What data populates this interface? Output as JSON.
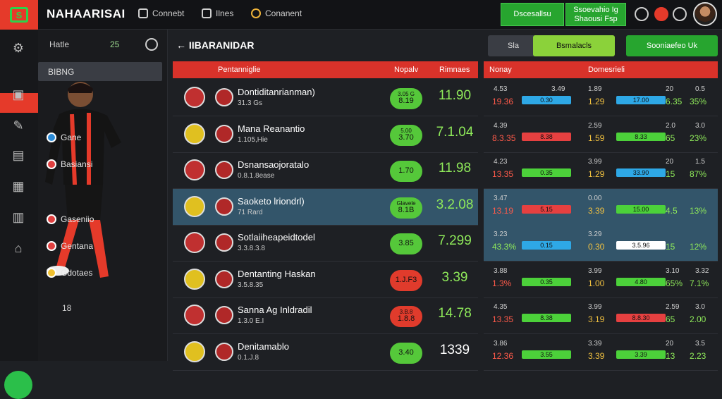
{
  "brand": {
    "logo": "S",
    "name": "NAHAARISAI"
  },
  "nav": [
    {
      "label": "Connebt",
      "icon": "link-icon"
    },
    {
      "label": "Ilnes",
      "icon": "list-icon"
    },
    {
      "label": "Conanent",
      "icon": "ball-icon"
    }
  ],
  "top_buttons": [
    {
      "label": "Dscesallsu"
    },
    {
      "label": "Ssoevahio Ig Shaousi Fsp"
    }
  ],
  "sidebar": {
    "header": "Hatle",
    "badge": "25",
    "selected": "BIBNG",
    "items": [
      {
        "label": "Gane"
      },
      {
        "label": "Basiansi"
      },
      {
        "label": "Gaseniio"
      },
      {
        "label": "Gentana"
      },
      {
        "label": "Gdotaes"
      }
    ],
    "footer_number": "18"
  },
  "breadcrumb": "IIBARANIDAR",
  "segments": [
    {
      "label": "Sla"
    },
    {
      "label": "Bsmalacls"
    },
    {
      "label": "Sooniaefeo Uk"
    }
  ],
  "table_header": {
    "col1": "Pentanniglie",
    "col2": "Nopalv",
    "col3": "Rimnaes"
  },
  "rows": [
    {
      "title": "Dontiditanrianman)",
      "sub": "31.3 Gs",
      "pill_top": "3.05 G",
      "pill_bot": "8.19",
      "value": "11.90",
      "hl": false,
      "pill": "#55c83a",
      "numc": "#8fea5a"
    },
    {
      "title": "Mana Reanantio",
      "sub": "1.105,Hie",
      "pill_top": "5.00",
      "pill_bot": "3.70",
      "value": "7.1.04",
      "hl": false,
      "pill": "#55c83a",
      "numc": "#8fea5a"
    },
    {
      "title": "Dsnansaojoratalo",
      "sub": "0.8.1.8ease",
      "pill_top": "",
      "pill_bot": "1.70",
      "value": "11.98",
      "hl": false,
      "pill": "#55c83a",
      "numc": "#8fea5a"
    },
    {
      "title": "Saoketo lriondrl)",
      "sub": "71 Rard",
      "pill_top": "Glavele",
      "pill_bot": "8.1B",
      "value": "3.2.08",
      "hl": true,
      "pill": "#55c83a",
      "numc": "#8fea5a"
    },
    {
      "title": "Sotlaiiheapeidtodel",
      "sub": "3.3.8.3.8",
      "pill_top": "",
      "pill_bot": "3.85",
      "value": "7.299",
      "hl": false,
      "pill": "#55c83a",
      "numc": "#8fea5a"
    },
    {
      "title": "Dentanting Haskan",
      "sub": "3.5.8.35",
      "pill_top": "",
      "pill_bot": "1.J.F3",
      "value": "3.39",
      "hl": false,
      "pill": "#e03b2c",
      "numc": "#8fea5a"
    },
    {
      "title": "Sanna Ag Inldradil",
      "sub": "1.3.0 E.I",
      "pill_top": "3.B.8",
      "pill_bot": "1.8.8",
      "value": "14.78",
      "hl": false,
      "pill": "#e03b2c",
      "numc": "#8fea5a"
    },
    {
      "title": "Denitamablo",
      "sub": "0.1.J.8",
      "pill_top": "",
      "pill_bot": "3.40",
      "value": "1339",
      "hl": false,
      "pill": "#55c83a",
      "numc": "#ffffff"
    }
  ],
  "right_header": {
    "col1": "Nonay",
    "col2": "Domesrieli"
  },
  "right_rows": [
    {
      "a": "4.53",
      "b": "19.36",
      "bc": "#ff5a4a",
      "m": "3.49",
      "bar1": "0.30",
      "c1": "#2ea8e6",
      "c": "1.89",
      "d": "1.29",
      "bar2": "17.00",
      "c2": "#2ea8e6",
      "e": "20",
      "f": "6.35",
      "g": "0.5",
      "h": "35%",
      "hl": false
    },
    {
      "a": "4.39",
      "b": "8.3.35",
      "bc": "#ff5a4a",
      "m": "",
      "bar1": "8.38",
      "c1": "#e64040",
      "c": "2.59",
      "d": "1.59",
      "bar2": "8.33",
      "c2": "#4cd13a",
      "e": "2.0",
      "f": "65",
      "g": "3.0",
      "h": "23%",
      "hl": false
    },
    {
      "a": "4.23",
      "b": "13.35",
      "bc": "#ff5a4a",
      "m": "",
      "bar1": "0.35",
      "c1": "#4cd13a",
      "c": "3.99",
      "d": "1.29",
      "bar2": "33.90",
      "c2": "#2ea8e6",
      "e": "20",
      "f": "15",
      "g": "1.5",
      "h": "87%",
      "hl": false
    },
    {
      "a": "3.47",
      "b": "13.19",
      "bc": "#ff5a4a",
      "m": "",
      "bar1": "5.15",
      "c1": "#e64040",
      "c": "0.00",
      "d": "3.39",
      "bar2": "15.00",
      "c2": "#4cd13a",
      "e": "",
      "f": "4.5",
      "g": "",
      "h": "13%",
      "hl": true
    },
    {
      "a": "3.23",
      "b": "43.3%",
      "bc": "#8fea5a",
      "m": "",
      "bar1": "0.15",
      "c1": "#2ea8e6",
      "c": "3.29",
      "d": "0.30",
      "bar2": "3.5.96",
      "c2": "#ffffff",
      "e": "",
      "f": "15",
      "g": "",
      "h": "12%",
      "hl": true
    },
    {
      "a": "3.88",
      "b": "1.3%",
      "bc": "#ff5a4a",
      "m": "",
      "bar1": "0.35",
      "c1": "#4cd13a",
      "c": "3.99",
      "d": "1.00",
      "bar2": "4.80",
      "c2": "#4cd13a",
      "e": "3.10",
      "f": "65%",
      "g": "3.32",
      "h": "7.1%",
      "hl": false
    },
    {
      "a": "4.35",
      "b": "13.35",
      "bc": "#ff5a4a",
      "m": "",
      "bar1": "8.38",
      "c1": "#4cd13a",
      "c": "3.99",
      "d": "3.19",
      "bar2": "8.8.30",
      "c2": "#e64040",
      "e": "2.59",
      "f": "65",
      "g": "3.0",
      "h": "2.00",
      "hl": false
    },
    {
      "a": "3.86",
      "b": "12.36",
      "bc": "#ff5a4a",
      "m": "",
      "bar1": "3.55",
      "c1": "#4cd13a",
      "c": "3.39",
      "d": "3.39",
      "bar2": "3.39",
      "c2": "#4cd13a",
      "e": "20",
      "f": "13",
      "g": "3.5",
      "h": "2.23",
      "hl": false
    }
  ],
  "colors": {
    "accent": "#e53a2a",
    "green": "#27a52f",
    "highlight": "#33556a"
  }
}
